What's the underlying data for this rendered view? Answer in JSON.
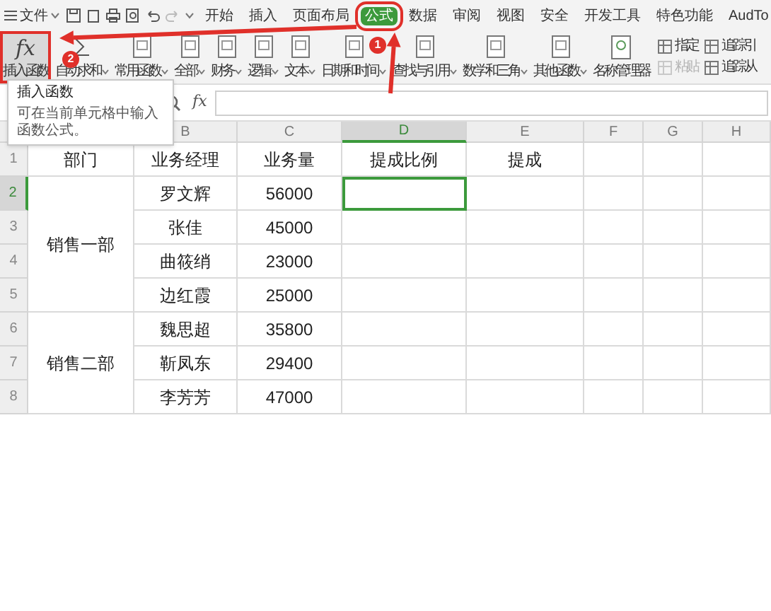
{
  "menu": {
    "label": "文件"
  },
  "tabs": [
    {
      "label": "开始",
      "selected": false,
      "highlighted": false
    },
    {
      "label": "插入",
      "selected": false,
      "highlighted": false
    },
    {
      "label": "页面布局",
      "selected": false,
      "highlighted": false
    },
    {
      "label": "公式",
      "selected": true,
      "highlighted": true
    },
    {
      "label": "数据",
      "selected": false,
      "highlighted": false
    },
    {
      "label": "审阅",
      "selected": false,
      "highlighted": false
    },
    {
      "label": "视图",
      "selected": false,
      "highlighted": false
    },
    {
      "label": "安全",
      "selected": false,
      "highlighted": false
    },
    {
      "label": "开发工具",
      "selected": false,
      "highlighted": false
    },
    {
      "label": "特色功能",
      "selected": false,
      "highlighted": false
    },
    {
      "label": "AudTo",
      "selected": false,
      "highlighted": false
    }
  ],
  "ribbon": [
    {
      "kind": "fx",
      "symbol": "fx",
      "label": "插入函数",
      "highlighted": true
    },
    {
      "kind": "sum",
      "label": "自动求和",
      "highlighted": false
    },
    {
      "kind": "dropdown",
      "label": "常用函数",
      "highlighted": false
    },
    {
      "kind": "dropdown",
      "label": "全部",
      "highlighted": false
    },
    {
      "kind": "dropdown",
      "label": "财务",
      "highlighted": false
    },
    {
      "kind": "dropdown",
      "label": "逻辑",
      "highlighted": false
    },
    {
      "kind": "dropdown",
      "label": "文本",
      "highlighted": false
    },
    {
      "kind": "dropdown",
      "label": "日期和时间",
      "highlighted": false
    },
    {
      "kind": "dropdown",
      "label": "查找与引用",
      "highlighted": false
    },
    {
      "kind": "dropdown",
      "label": "数学和三角",
      "highlighted": false
    },
    {
      "kind": "dropdown",
      "label": "其他函数",
      "highlighted": false
    },
    {
      "kind": "large",
      "label": "名称管理器",
      "highlighted": false
    },
    {
      "kind": "pair",
      "items": [
        {
          "label": "指定",
          "disabled": false
        },
        {
          "label": "粘贴",
          "disabled": true
        }
      ]
    },
    {
      "kind": "pair",
      "items": [
        {
          "label": "追踪引",
          "disabled": false
        },
        {
          "label": "追踪从",
          "disabled": false
        }
      ]
    }
  ],
  "tooltip": {
    "title": "插入函数",
    "body": "可在当前单元格中输入函数公式。"
  },
  "formula_bar": {
    "label": "fx"
  },
  "sheet": {
    "columns": [
      {
        "label": "B",
        "selected": false
      },
      {
        "label": "C",
        "selected": false
      },
      {
        "label": "D",
        "selected": true
      },
      {
        "label": "E",
        "selected": false
      },
      {
        "label": "F",
        "selected": false
      },
      {
        "label": "G",
        "selected": false
      },
      {
        "label": "H",
        "selected": false
      }
    ],
    "row_numbers": [
      {
        "label": "1",
        "selected": false
      },
      {
        "label": "2",
        "selected": true
      },
      {
        "label": "3",
        "selected": false
      },
      {
        "label": "4",
        "selected": false
      },
      {
        "label": "5",
        "selected": false
      },
      {
        "label": "6",
        "selected": false
      },
      {
        "label": "7",
        "selected": false
      },
      {
        "label": "8",
        "selected": false
      }
    ],
    "header": [
      "部门",
      "业务经理",
      "业务量",
      "提成比例",
      "提成"
    ],
    "groups": [
      {
        "department": "销售一部",
        "rows": [
          {
            "manager": "罗文辉",
            "volume": "56000",
            "rate_selected": true
          },
          {
            "manager": "张佳",
            "volume": "45000",
            "rate_selected": false
          },
          {
            "manager": "曲筱绡",
            "volume": "23000",
            "rate_selected": false
          },
          {
            "manager": "边红霞",
            "volume": "25000",
            "rate_selected": false
          }
        ]
      },
      {
        "department": "销售二部",
        "rows": [
          {
            "manager": "魏思超",
            "volume": "35800",
            "rate_selected": false
          },
          {
            "manager": "靳凤东",
            "volume": "29400",
            "rate_selected": false
          },
          {
            "manager": "李芳芳",
            "volume": "47000",
            "rate_selected": false
          }
        ]
      }
    ]
  },
  "annotations": [
    {
      "label": "1"
    },
    {
      "label": "2"
    }
  ]
}
